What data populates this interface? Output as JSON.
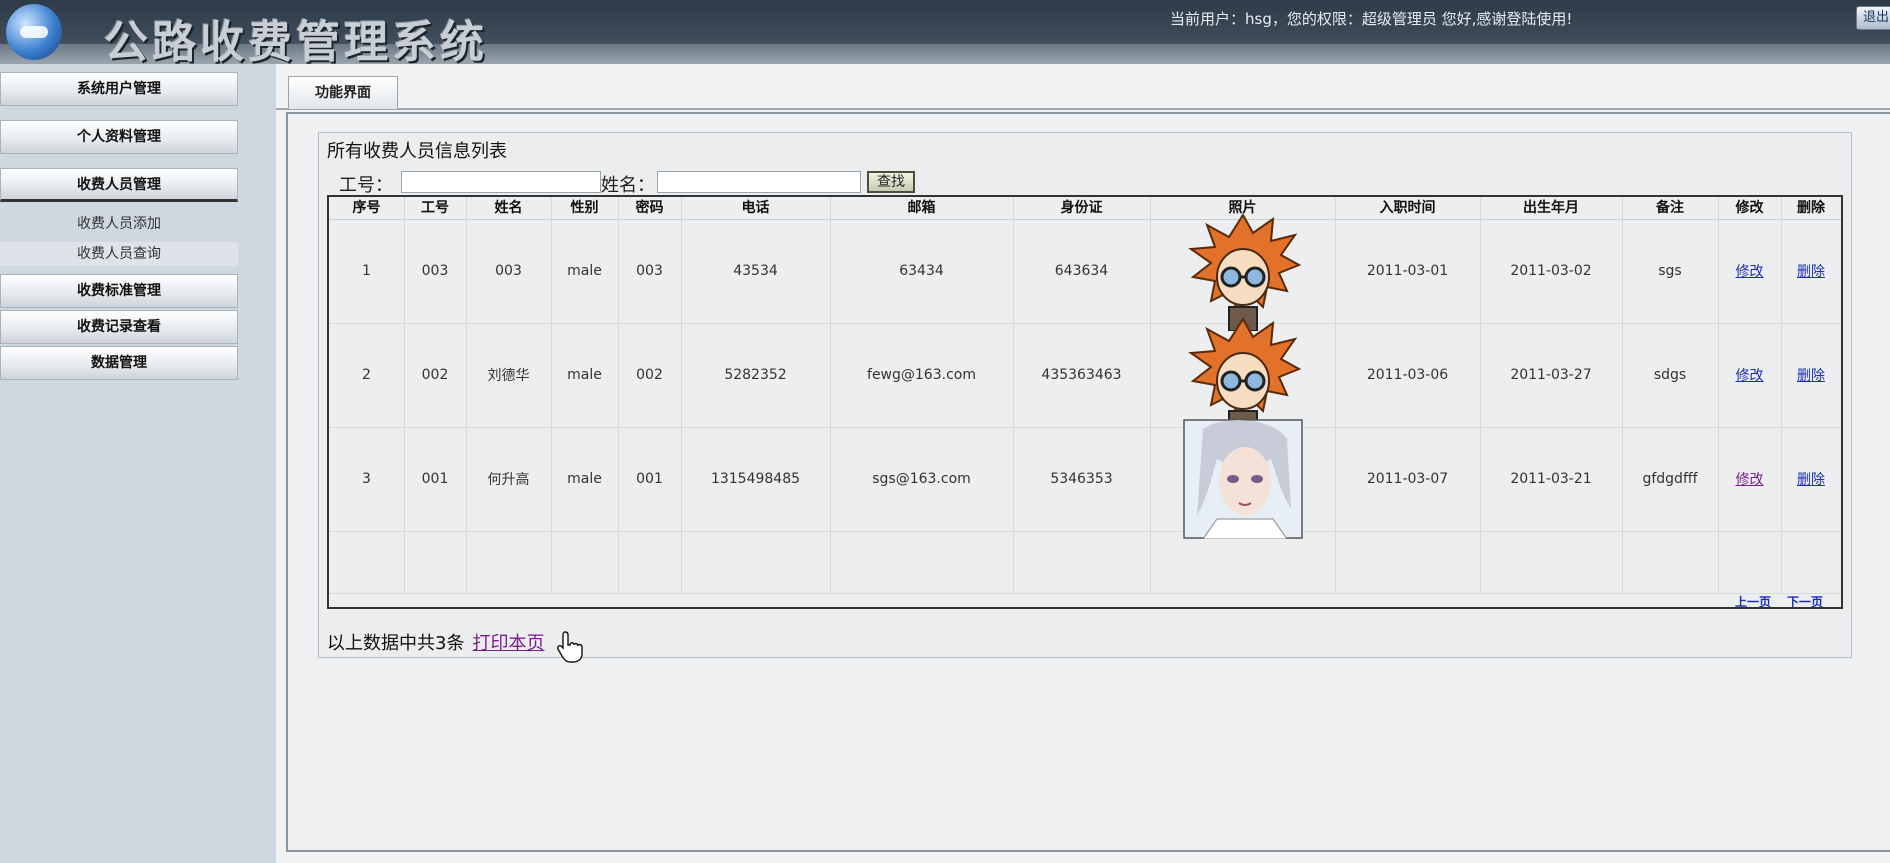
{
  "header": {
    "system_title": "公路收费管理系统",
    "user_info": "当前用户：hsg，您的权限：超级管理员 您好,感谢登陆使用!",
    "logout_label": "退出"
  },
  "sidebar": {
    "menus": [
      {
        "label": "系统用户管理"
      },
      {
        "label": "个人资料管理"
      },
      {
        "label": "收费人员管理"
      },
      {
        "label": "收费标准管理"
      },
      {
        "label": "收费记录查看"
      },
      {
        "label": "数据管理"
      }
    ],
    "sub_items": [
      {
        "label": "收费人员添加"
      },
      {
        "label": "收费人员查询"
      }
    ]
  },
  "main": {
    "tab_label": "功能界面",
    "panel_title": "所有收费人员信息列表",
    "search": {
      "id_label": "工号：",
      "id_value": "",
      "name_label": "姓名：",
      "name_value": "",
      "button_label": "查找"
    },
    "table": {
      "headers": [
        "序号",
        "工号",
        "姓名",
        "性别",
        "密码",
        "电话",
        "邮箱",
        "身份证",
        "照片",
        "入职时间",
        "出生年月",
        "备注",
        "修改",
        "删除"
      ],
      "rows": [
        {
          "no": "1",
          "id": "003",
          "name": "003",
          "gender": "male",
          "password": "003",
          "phone": "43534",
          "email": "63434",
          "idcard": "643634",
          "photo": "orange-hair-avatar",
          "hire_date": "2011-03-01",
          "birth": "2011-03-02",
          "note": "sgs",
          "edit": "修改",
          "delete": "删除"
        },
        {
          "no": "2",
          "id": "002",
          "name": "刘德华",
          "gender": "male",
          "password": "002",
          "phone": "5282352",
          "email": "fewg@163.com",
          "idcard": "435363463",
          "photo": "orange-hair-avatar",
          "hire_date": "2011-03-06",
          "birth": "2011-03-27",
          "note": "sdgs",
          "edit": "修改",
          "delete": "删除"
        },
        {
          "no": "3",
          "id": "001",
          "name": "何升高",
          "gender": "male",
          "password": "001",
          "phone": "1315498485",
          "email": "sgs@163.com",
          "idcard": "5346353",
          "photo": "silver-hair-avatar",
          "hire_date": "2011-03-07",
          "birth": "2011-03-21",
          "note": "gfdgdfff",
          "edit": "修改",
          "delete": "删除"
        }
      ],
      "prev_page": "上一页",
      "next_page": "下一页"
    },
    "summary": "以上数据中共3条",
    "print_label": "打印本页"
  },
  "colors": {
    "link": "#1a2fb8",
    "visited_link": "#7a1f8f",
    "header_bg": "#2e3b48"
  }
}
